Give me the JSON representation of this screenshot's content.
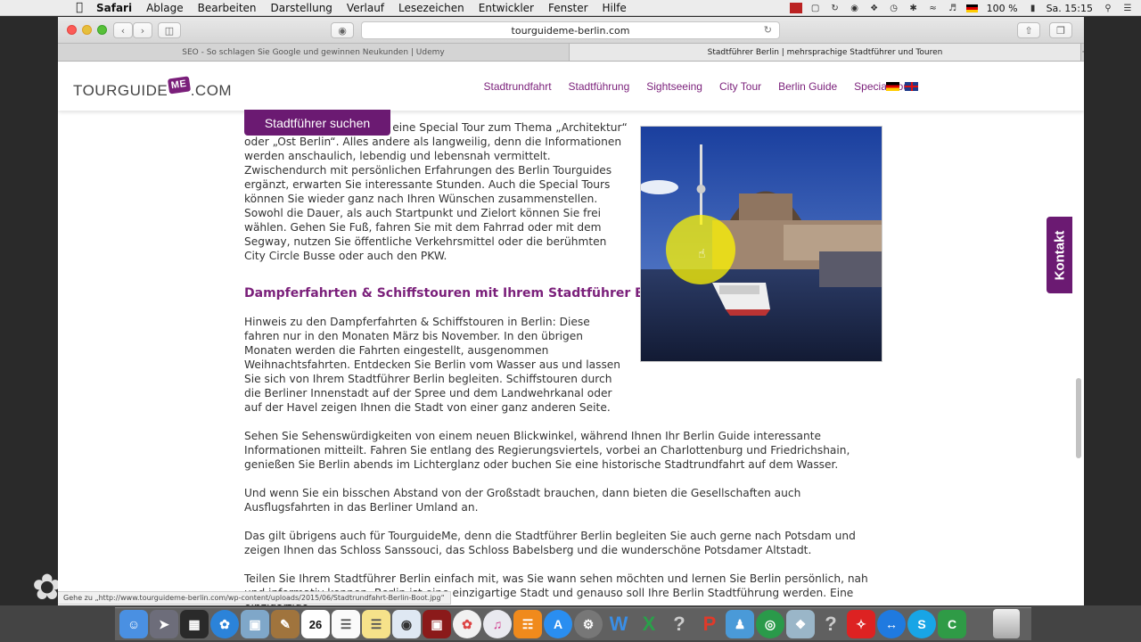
{
  "menubar": {
    "app": "Safari",
    "items": [
      "Ablage",
      "Bearbeiten",
      "Darstellung",
      "Verlauf",
      "Lesezeichen",
      "Entwickler",
      "Fenster",
      "Hilfe"
    ],
    "battery": "100 %",
    "clock": "Sa. 15:15"
  },
  "browser": {
    "url": "tourguideme-berlin.com",
    "tabs": [
      {
        "title": "SEO - So schlagen Sie Google und gewinnen Neukunden | Udemy",
        "active": false
      },
      {
        "title": "Stadtführer Berlin | mehrsprachige Stadtführer und Touren",
        "active": true
      }
    ],
    "status_url": "Gehe zu „http://www.tourguideme-berlin.com/wp-content/uploads/2015/06/Stadtrundfahrt-Berlin-Boot.jpg“"
  },
  "site": {
    "logo": {
      "part1": "TOURGUIDE",
      "me": "ME",
      "part2": ".COM"
    },
    "nav": [
      "Stadtrundfahrt",
      "Stadtführung",
      "Sightseeing",
      "City Tour",
      "Berlin Guide",
      "Special Tours"
    ],
    "search_button": "Stadtführer suchen",
    "kontakt": "Kontakt",
    "intro_paragraph": "Sachsenhausen besuchen, eine Special Tour zum Thema „Architektur“ oder „Ost Berlin“. Alles andere als langweilig, denn die Informationen werden anschaulich, lebendig und lebensnah vermittelt. Zwischendurch mit persönlichen Erfahrungen des Berlin Tourguides ergänzt, erwarten Sie interessante Stunden. Auch die Special Tours können Sie wieder ganz nach Ihren Wünschen zusammenstellen. Sowohl die Dauer, als auch Startpunkt und Zielort können Sie frei wählen. Gehen Sie Fuß, fahren Sie mit dem Fahrrad oder mit dem Segway, nutzen Sie öffentliche Verkehrsmittel oder die berühmten City Circle Busse oder auch den PKW.",
    "heading": "Dampferfahrten & Schiffstouren mit Ihrem Stadtführer Berlin",
    "paragraphs": [
      "Hinweis zu den Dampferfahrten & Schiffstouren in Berlin: Diese fahren nur in den Monaten März bis November. In den übrigen Monaten werden die Fahrten eingestellt, ausgenommen Weihnachtsfahrten. Entdecken Sie Berlin vom Wasser aus und lassen Sie sich von Ihrem Stadtführer Berlin begleiten. Schiffstouren durch die Berliner Innenstadt auf der Spree und dem Landwehrkanal oder auf der Havel zeigen Ihnen die Stadt von einer ganz anderen Seite.",
      "Sehen Sie Sehenswürdigkeiten von einem neuen Blickwinkel, während Ihnen Ihr Berlin Guide interessante Informationen mitteilt. Fahren Sie entlang des Regierungsviertels, vorbei an Charlottenburg und Friedrichshain, genießen Sie Berlin abends im Lichterglanz oder buchen Sie eine historische Stadtrundfahrt auf dem Wasser.",
      "Und wenn Sie ein bisschen Abstand von der Großstadt brauchen, dann bieten die Gesellschaften auch Ausflugsfahrten in das Berliner Umland an.",
      "Das gilt übrigens auch für TourguideMe, denn die Stadtführer Berlin begleiten Sie auch gerne nach Potsdam und zeigen Ihnen das Schloss Sanssouci, das Schloss Babelsberg und die wunderschöne Potsdamer Altstadt.",
      "Teilen Sie Ihrem Stadtführer Berlin einfach mit, was Sie wann sehen möchten und lernen Sie Berlin persönlich, nah und informativ kennen. Berlin ist eine einzigartige Stadt und genauso soll Ihre Berlin Stadtführung werden. Eine einzigartige"
    ]
  },
  "dock": {
    "calendar_day": "26",
    "icons": [
      "finder-icon",
      "launchpad-icon",
      "mission-control-icon",
      "safari-icon",
      "preview-icon",
      "contacts-icon",
      "calendar-icon",
      "reminders-icon",
      "notes-icon",
      "messages-icon",
      "photo-booth-icon",
      "photos-icon",
      "itunes-icon",
      "ibooks-icon",
      "app-store-icon",
      "system-preferences-icon",
      "word-icon",
      "excel-icon",
      "unknown-app-icon",
      "powerpoint-icon",
      "people-icon",
      "network-icon",
      "utility-icon",
      "unknown-app-icon-2",
      "acrobat-icon",
      "teamviewer-icon",
      "skype-icon",
      "camtasia-icon"
    ]
  }
}
